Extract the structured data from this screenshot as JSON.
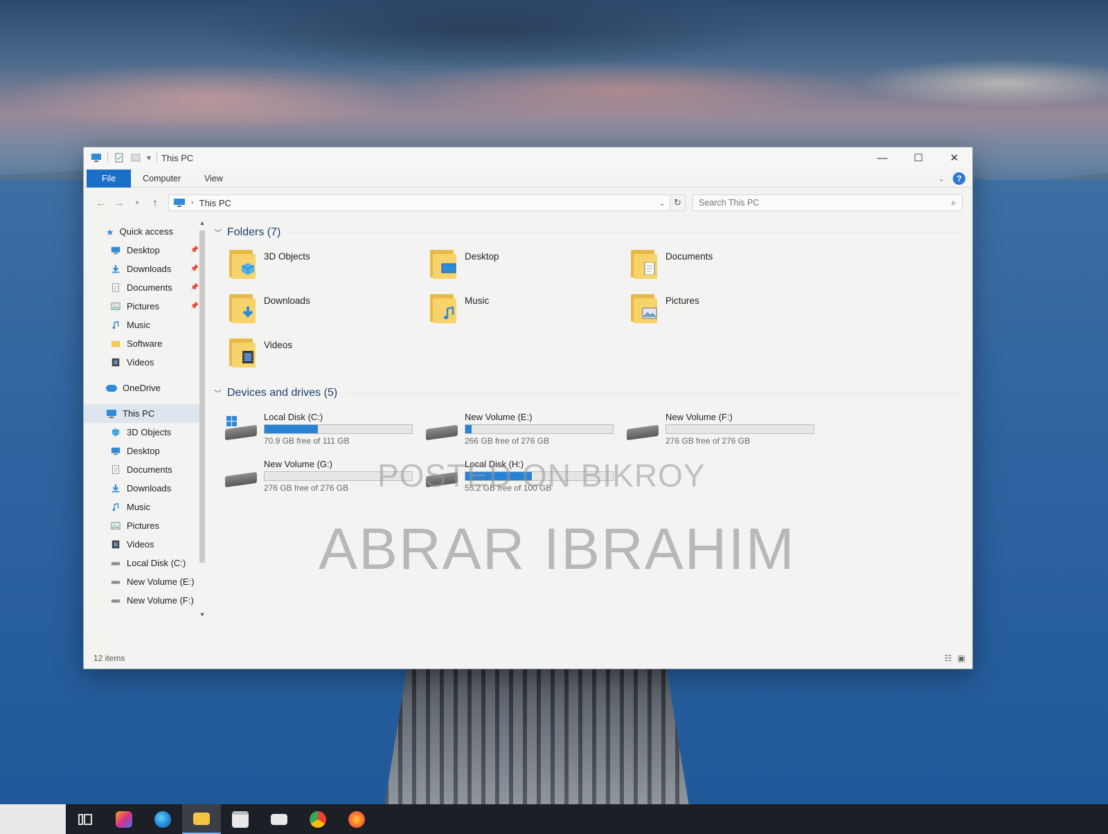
{
  "window": {
    "title": "This PC",
    "controls": {
      "minimize": "—",
      "maximize": "☐",
      "close": "✕"
    }
  },
  "ribbon": {
    "tabs": [
      "File",
      "Computer",
      "View"
    ],
    "help": "?"
  },
  "navbar": {
    "back": "←",
    "forward": "→",
    "up": "↑",
    "address_location": "This PC",
    "search_placeholder": "Search This PC"
  },
  "nav_pane": {
    "quick_access": "Quick access",
    "quick_items": [
      {
        "label": "Desktop",
        "icon": "desktop-icon",
        "pinned": true
      },
      {
        "label": "Downloads",
        "icon": "downloads-icon",
        "pinned": true
      },
      {
        "label": "Documents",
        "icon": "documents-icon",
        "pinned": true
      },
      {
        "label": "Pictures",
        "icon": "pictures-icon",
        "pinned": true
      },
      {
        "label": "Music",
        "icon": "music-icon",
        "pinned": false
      },
      {
        "label": "Software",
        "icon": "folder-icon",
        "pinned": false
      },
      {
        "label": "Videos",
        "icon": "videos-icon",
        "pinned": false
      }
    ],
    "onedrive": "OneDrive",
    "this_pc": "This PC",
    "pc_items": [
      {
        "label": "3D Objects",
        "icon": "3d-objects-icon"
      },
      {
        "label": "Desktop",
        "icon": "desktop-icon"
      },
      {
        "label": "Documents",
        "icon": "documents-icon"
      },
      {
        "label": "Downloads",
        "icon": "downloads-icon"
      },
      {
        "label": "Music",
        "icon": "music-icon"
      },
      {
        "label": "Pictures",
        "icon": "pictures-icon"
      },
      {
        "label": "Videos",
        "icon": "videos-icon"
      },
      {
        "label": "Local Disk (C:)",
        "icon": "drive-icon"
      },
      {
        "label": "New Volume (E:)",
        "icon": "drive-icon"
      },
      {
        "label": "New Volume (F:)",
        "icon": "drive-icon"
      }
    ]
  },
  "content": {
    "folders_header": "Folders (7)",
    "folders": [
      {
        "label": "3D Objects",
        "icon": "3d-objects-icon"
      },
      {
        "label": "Desktop",
        "icon": "desktop-icon"
      },
      {
        "label": "Documents",
        "icon": "documents-icon"
      },
      {
        "label": "Downloads",
        "icon": "downloads-icon"
      },
      {
        "label": "Music",
        "icon": "music-icon"
      },
      {
        "label": "Pictures",
        "icon": "pictures-icon"
      },
      {
        "label": "Videos",
        "icon": "videos-icon"
      }
    ],
    "drives_header": "Devices and drives (5)",
    "drives": [
      {
        "label": "Local Disk (C:)",
        "free": "70.9 GB free of 111 GB",
        "used_fraction": 0.36,
        "system": true
      },
      {
        "label": "New Volume (E:)",
        "free": "266 GB free of 276 GB",
        "used_fraction": 0.04,
        "system": false
      },
      {
        "label": "New Volume (F:)",
        "free": "276 GB free of 276 GB",
        "used_fraction": 0.0,
        "system": false
      },
      {
        "label": "New Volume (G:)",
        "free": "276 GB free of 276 GB",
        "used_fraction": 0.0,
        "system": false
      },
      {
        "label": "Local Disk (H:)",
        "free": "55.2 GB free of 100 GB",
        "used_fraction": 0.45,
        "system": false
      }
    ]
  },
  "status": {
    "items": "12 items"
  },
  "watermark": {
    "line1": "POSTED ON BIKROY",
    "line2": "ABRAR IBRAHIM"
  },
  "colors": {
    "accent": "#1a6fc8",
    "drive_fill": "#2683d6",
    "folder": "#f6d36b"
  },
  "taskbar": {
    "icons": [
      "task-view-icon",
      "office-icon",
      "edge-icon",
      "file-explorer-icon",
      "store-icon",
      "mail-icon",
      "chrome-icon",
      "firefox-icon"
    ]
  }
}
